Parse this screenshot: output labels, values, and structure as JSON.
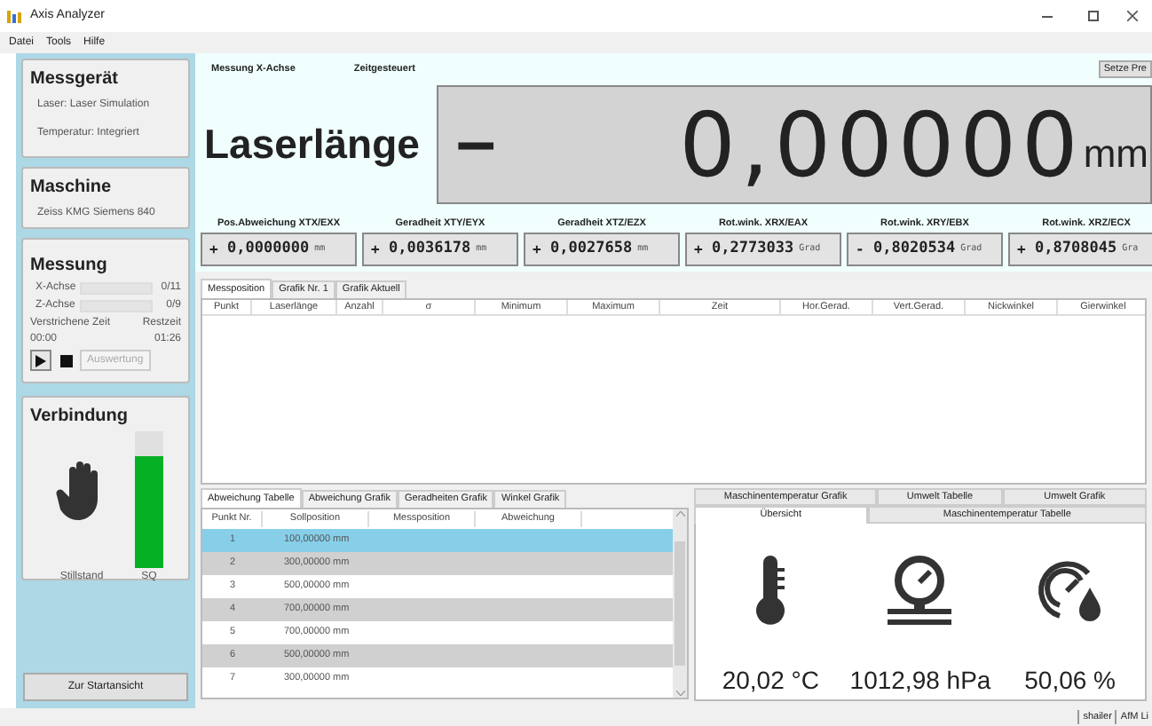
{
  "window": {
    "title": "Axis Analyzer"
  },
  "menu": [
    "Datei",
    "Tools",
    "Hilfe"
  ],
  "sidebar": {
    "messgeraet": {
      "title": "Messgerät",
      "lines": [
        "Laser: Laser Simulation",
        "Temperatur: Integriert"
      ]
    },
    "maschine": {
      "title": "Maschine",
      "lines": [
        "Zeiss KMG Siemens 840"
      ]
    },
    "messung": {
      "title": "Messung",
      "axes": [
        {
          "label": "X-Achse",
          "level": 0,
          "count": "0/11"
        },
        {
          "label": "Z-Achse",
          "level": 0,
          "count": "0/9"
        }
      ],
      "elapsed_label": "Verstrichene Zeit",
      "remaining_label": "Restzeit",
      "elapsed": "00:00",
      "remaining": "01:26",
      "evaluate_button": {
        "label": "Auswertung",
        "disabled": true
      }
    },
    "verbindung": {
      "title": "Verbindung",
      "state": "Stillstand",
      "signal_label": "SQ",
      "level": 0.82
    },
    "start_button": "Zur Startansicht"
  },
  "header": {
    "labels": [
      "Messung X-Achse",
      "Zeitgesteuert"
    ],
    "preset_button": "Setze Pre"
  },
  "display": {
    "label": "Laserlänge",
    "sign": "–",
    "value": "0,00000",
    "unit": "mm"
  },
  "readouts": [
    {
      "label": "Pos.Abweichung XTX/EXX",
      "sign": "+",
      "value": "0,0000000",
      "unit": "mm"
    },
    {
      "label": "Geradheit XTY/EYX",
      "sign": "+",
      "value": "0,0036178",
      "unit": "mm"
    },
    {
      "label": "Geradheit XTZ/EZX",
      "sign": "+",
      "value": "0,0027658",
      "unit": "mm"
    },
    {
      "label": "Rot.wink. XRX/EAX",
      "sign": "+",
      "value": "0,2773033",
      "unit": "Grad"
    },
    {
      "label": "Rot.wink. XRY/EBX",
      "sign": "-",
      "value": "0,8020534",
      "unit": "Grad"
    },
    {
      "label": "Rot.wink. XRZ/ECX",
      "sign": "+",
      "value": "0,8708045",
      "unit": "Gra"
    }
  ],
  "upper_tabs": [
    {
      "label": "Messposition",
      "selected": true
    },
    {
      "label": "Grafik Nr. 1",
      "selected": false
    },
    {
      "label": "Grafik Aktuell",
      "selected": false
    }
  ],
  "upper_table": {
    "columns": [
      "Punkt",
      "Laserlänge",
      "Anzahl",
      "σ",
      "Minimum",
      "Maximum",
      "Zeit",
      "Hor.Gerad.",
      "Vert.Gerad.",
      "Nickwinkel",
      "Gierwinkel"
    ]
  },
  "lower_tabs": [
    {
      "label": "Abweichung Tabelle",
      "selected": true
    },
    {
      "label": "Abweichung Grafik",
      "selected": false
    },
    {
      "label": "Geradheiten Grafik",
      "selected": false
    },
    {
      "label": "Winkel Grafik",
      "selected": false
    }
  ],
  "lower_table": {
    "columns": [
      "Punkt Nr.",
      "Sollposition",
      "Messposition",
      "Abweichung"
    ],
    "rows": [
      {
        "cells": [
          "1",
          "100,00000 mm"
        ],
        "selected": true
      },
      {
        "cells": [
          "2",
          "300,00000 mm"
        ],
        "selected": false
      },
      {
        "cells": [
          "3",
          "500,00000 mm"
        ],
        "selected": false
      },
      {
        "cells": [
          "4",
          "700,00000 mm"
        ],
        "selected": false
      },
      {
        "cells": [
          "5",
          "700,00000 mm"
        ],
        "selected": false
      },
      {
        "cells": [
          "6",
          "500,00000 mm"
        ],
        "selected": false
      },
      {
        "cells": [
          "7",
          "300,00000 mm"
        ],
        "selected": false
      }
    ]
  },
  "env_tabs_top": [
    {
      "label": "Maschinentemperatur Grafik",
      "selected": false
    },
    {
      "label": "Umwelt Tabelle",
      "selected": false
    },
    {
      "label": "Umwelt Grafik",
      "selected": false
    }
  ],
  "env_tabs_bottom": [
    {
      "label": "Übersicht",
      "selected": true
    },
    {
      "label": "Maschinentemperatur Tabelle",
      "selected": false
    }
  ],
  "environment": [
    {
      "kind": "temperature",
      "value": "20,02 °C"
    },
    {
      "kind": "pressure",
      "value": "1012,98 hPa"
    },
    {
      "kind": "humidity",
      "value": "50,06 %"
    }
  ],
  "status_bar": [
    "shailer",
    "AfM Li"
  ]
}
